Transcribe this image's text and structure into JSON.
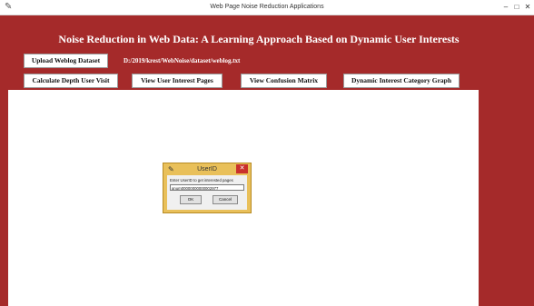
{
  "window": {
    "title": "Web Page Noise Reduction Applications",
    "app_icon": "feather-icon",
    "controls": {
      "minimize": "–",
      "maximize": "□",
      "close": "✕"
    }
  },
  "header": {
    "title": "Noise Reduction in Web Data: A Learning Approach Based on Dynamic User Interests"
  },
  "toolbar": {
    "upload_label": "Upload Weblog Dataset",
    "dataset_path": "D:/2019/krest/WebNoise/dataset/weblog.txt",
    "depth_label": "Calculate Depth User Visit",
    "interest_pages_label": "View User Interest Pages",
    "confusion_label": "View Confusion Matrix",
    "graph_label": "Dynamic Interest Category Graph"
  },
  "dialog": {
    "title": "UserID",
    "close": "✕",
    "prompt": "Enter UserID to get interested pages",
    "input_value": "anum00000000000002977",
    "ok_label": "OK",
    "cancel_label": "Cancel"
  },
  "colors": {
    "background": "#a52a2a",
    "canvas": "#ffffff",
    "dialog_frame": "#e9c05a",
    "close_button": "#c9302c"
  }
}
